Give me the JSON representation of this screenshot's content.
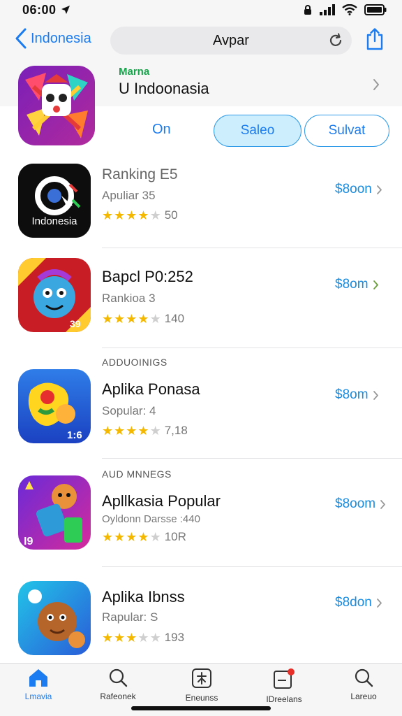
{
  "status": {
    "time": "06:00"
  },
  "nav": {
    "back_label": "Indonesia",
    "search_text": "Avpar"
  },
  "featured": {
    "label": "Marna",
    "title": "U Indoonasia",
    "segment_on": "On",
    "segment_sales": "Saleo",
    "segment_sulvat": "Sulvat"
  },
  "apps": [
    {
      "title": "Ranking E5",
      "subtitle": "Apuliar 35",
      "rating_count": "50",
      "stars": 4.5,
      "price": "$8oon",
      "icon_text": "Indonesia",
      "section_label": ""
    },
    {
      "title": "Bapcl P0:252",
      "subtitle": "Rankioa 3",
      "rating_count": "140",
      "stars": 4,
      "price": "$8om",
      "icon_text": "39",
      "section_label": ""
    },
    {
      "title": "Aplika Ponasa",
      "subtitle": "Sopular: 4",
      "rating_count": "7,18",
      "stars": 4.5,
      "price": "$8om",
      "icon_text": "1:6",
      "section_label": "ADDUOINIGS"
    },
    {
      "title": "Apllkasia Popular",
      "subtitle": "Oyldonn Darsse :440",
      "rating_count": "10R",
      "stars": 4,
      "price": "$8oom",
      "icon_text": "I9",
      "section_label": "AUD MNNEGS"
    },
    {
      "title": "Aplika Ibnss",
      "subtitle": "Rapular: S",
      "rating_count": "193",
      "stars": 3.5,
      "price": "$8don",
      "icon_text": "",
      "section_label": ""
    }
  ],
  "tabs": [
    {
      "label": "Lmavia"
    },
    {
      "label": "Rafeonek"
    },
    {
      "label": "Eneunss"
    },
    {
      "label": "IDreelans"
    },
    {
      "label": "Lareuo"
    }
  ],
  "colors": {
    "accent": "#1a7cf0",
    "star": "#f5b800",
    "segment_fill": "#cdeefc"
  }
}
